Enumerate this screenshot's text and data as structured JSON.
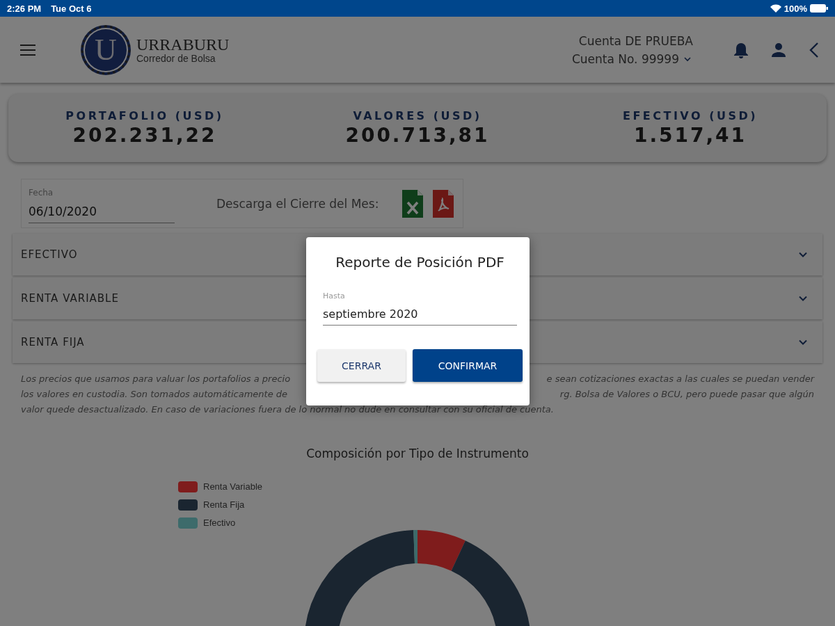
{
  "status_bar": {
    "time": "2:26 PM",
    "date": "Tue Oct 6",
    "battery": "100%"
  },
  "header": {
    "logo_letter": "U",
    "brand": "URRABURU",
    "tagline": "Corredor de Bolsa",
    "account_name": "Cuenta DE PRUEBA",
    "account_number": "Cuenta No. 99999"
  },
  "summary": [
    {
      "label": "PORTAFOLIO (USD)",
      "value": "202.231,22"
    },
    {
      "label": "VALORES (USD)",
      "value": "200.713,81"
    },
    {
      "label": "EFECTIVO (USD)",
      "value": "1.517,41"
    }
  ],
  "date_field": {
    "label": "Fecha",
    "value": "06/10/2020"
  },
  "download": {
    "label": "Descarga el Cierre del Mes:"
  },
  "sections": [
    {
      "title": "EFECTIVO",
      "expanded": false
    },
    {
      "title": "RENTA VARIABLE",
      "expanded": false
    },
    {
      "title": "RENTA FIJA",
      "expanded": false
    }
  ],
  "disclaimer_lines": [
    [
      "Los precios que usamos para valuar los portafolios a precio",
      "e sean cotizaciones exactas a las cuales se puedan vender"
    ],
    [
      "los valores en custodia. Son tomados automáticamente de",
      "rg. Bolsa de Valores o BCU, pero puede pasar que algún"
    ],
    [
      "valor quede desactualizado. En caso de variaciones fuera de lo normal no dude en consultar con su oficial de cuenta."
    ]
  ],
  "chart": {
    "title": "Composición por Tipo de Instrumento",
    "legend": [
      {
        "label": "Renta Variable",
        "color": "#7f1c1c"
      },
      {
        "label": "Renta Fija",
        "color": "#1a2530"
      },
      {
        "label": "Efectivo",
        "color": "#3d6b6b"
      }
    ]
  },
  "dialog": {
    "title": "Reporte de Posición PDF",
    "field": {
      "label": "Hasta",
      "value": "septiembre 2020"
    },
    "buttons": [
      {
        "label": "CERRAR",
        "kind": "secondary"
      },
      {
        "label": "CONFIRMAR",
        "kind": "primary"
      }
    ]
  }
}
